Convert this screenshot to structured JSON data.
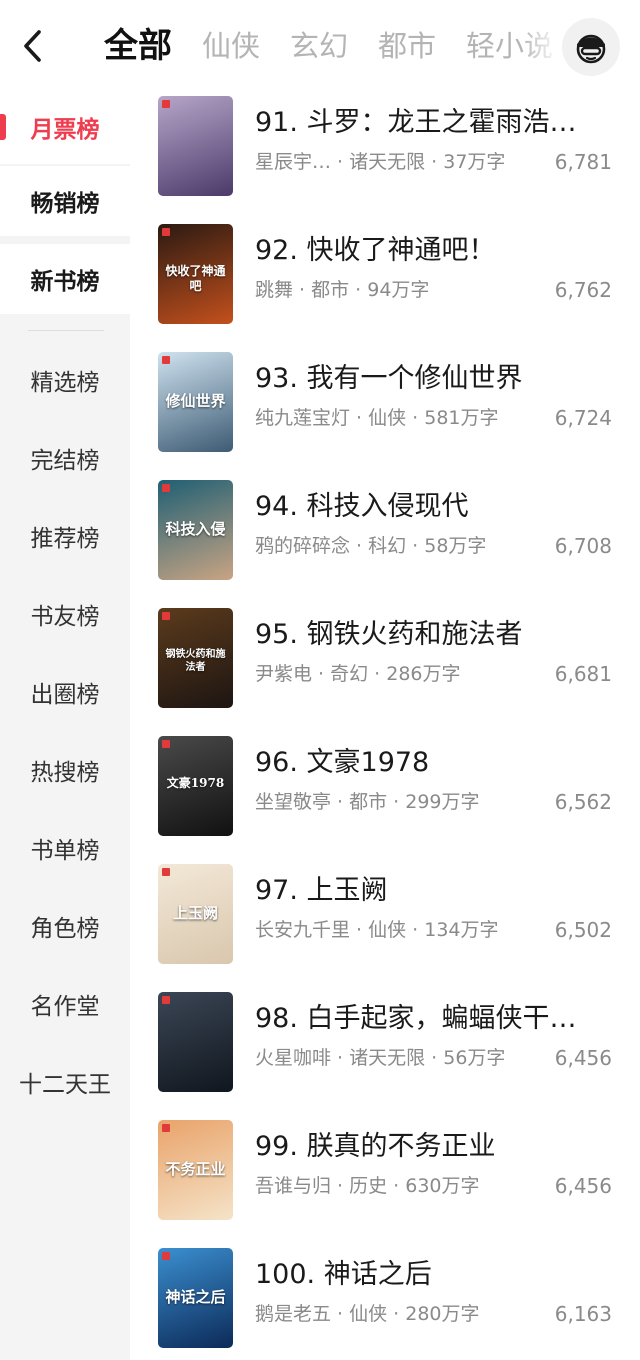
{
  "topbar": {
    "tabs": [
      "全部",
      "仙侠",
      "玄幻",
      "都市",
      "轻小说"
    ],
    "active_tab": "全部"
  },
  "sidebar": {
    "items": [
      "月票榜",
      "畅销榜",
      "新书榜",
      "精选榜",
      "完结榜",
      "推荐榜",
      "书友榜",
      "出圈榜",
      "热搜榜",
      "书单榜",
      "角色榜",
      "名作堂",
      "十二天王"
    ],
    "active_item": "月票榜"
  },
  "books": [
    {
      "title": "91. 斗罗：龙王之霍雨浩…",
      "meta": "星辰宇… · 诸天无限 · 37万字",
      "votes": "6,781",
      "cover_text": "",
      "cover_colors": [
        "#b7a6c9",
        "#4b3a6a"
      ]
    },
    {
      "title": "92. 快收了神通吧！",
      "meta": "跳舞 · 都市 · 94万字",
      "votes": "6,762",
      "cover_text": "快收了神通吧",
      "cover_colors": [
        "#2a1a12",
        "#c4501c"
      ]
    },
    {
      "title": "93. 我有一个修仙世界",
      "meta": "纯九莲宝灯 · 仙侠 · 581万字",
      "votes": "6,724",
      "cover_text": "修仙世界",
      "cover_colors": [
        "#cfe2ef",
        "#3d5b74"
      ]
    },
    {
      "title": "94. 科技入侵现代",
      "meta": "鸦的碎碎念 · 科幻 · 58万字",
      "votes": "6,708",
      "cover_text": "科技入侵",
      "cover_colors": [
        "#1f5f74",
        "#c9a483"
      ]
    },
    {
      "title": "95. 钢铁火药和施法者",
      "meta": "尹紫电 · 奇幻 · 286万字",
      "votes": "6,681",
      "cover_text": "钢铁火药和施法者",
      "cover_colors": [
        "#5c3b1c",
        "#1d1512"
      ]
    },
    {
      "title": "96. 文豪1978",
      "meta": "坐望敬亭 · 都市 · 299万字",
      "votes": "6,562",
      "cover_text": "文豪1978",
      "cover_colors": [
        "#4a4a4a",
        "#111111"
      ]
    },
    {
      "title": "97. 上玉阙",
      "meta": "长安九千里 · 仙侠 · 134万字",
      "votes": "6,502",
      "cover_text": "上玉阙",
      "cover_colors": [
        "#f3e8d8",
        "#d9c7ad"
      ]
    },
    {
      "title": "98. 白手起家，蝙蝠侠干…",
      "meta": "火星咖啡 · 诸天无限 · 56万字",
      "votes": "6,456",
      "cover_text": "",
      "cover_colors": [
        "#3b4655",
        "#10161e"
      ]
    },
    {
      "title": "99. 朕真的不务正业",
      "meta": "吾谁与归 · 历史 · 630万字",
      "votes": "6,456",
      "cover_text": "不务正业",
      "cover_colors": [
        "#e9a36a",
        "#f5e3c8"
      ]
    },
    {
      "title": "100. 神话之后",
      "meta": "鹅是老五 · 仙侠 · 280万字",
      "votes": "6,163",
      "cover_text": "神话之后",
      "cover_colors": [
        "#3b8fd0",
        "#0c2a58"
      ]
    }
  ],
  "colors": {
    "accent": "#ee3d4f",
    "sidebar_bg": "#f4f4f4",
    "muted": "#8a8a8a"
  },
  "icons": {
    "back": "chevron-left-icon",
    "profile": "avatar-icon"
  }
}
